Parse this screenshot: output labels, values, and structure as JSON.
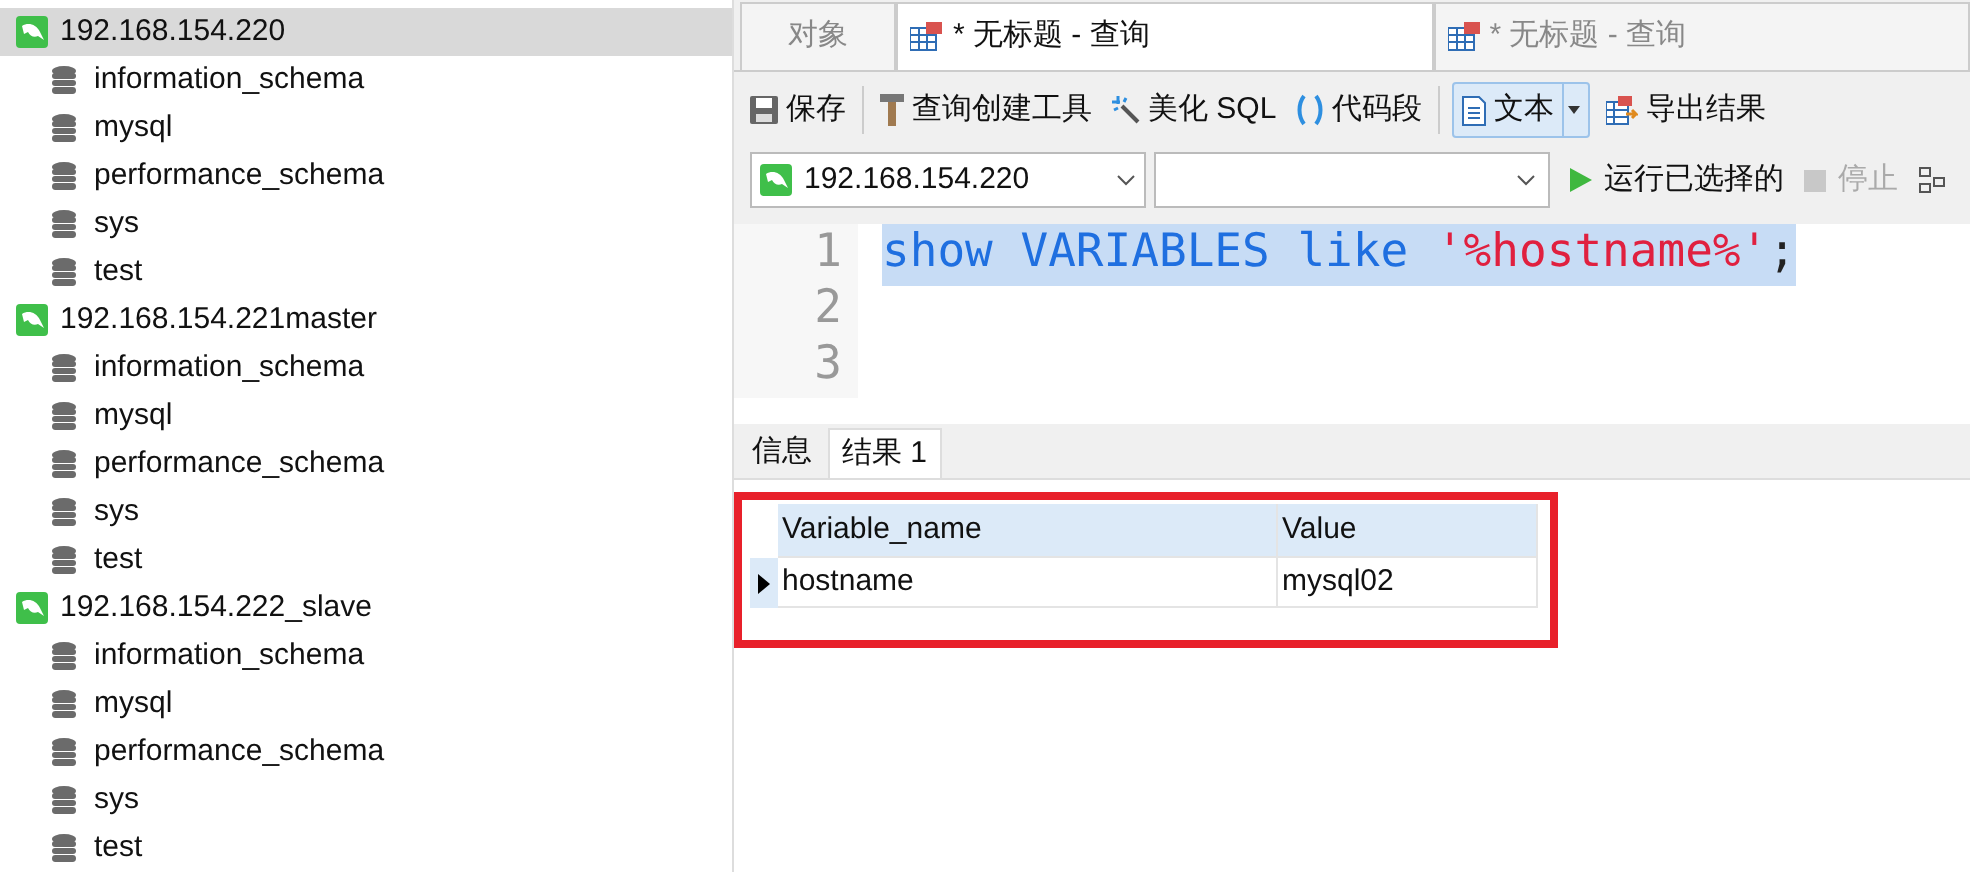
{
  "sidebar": {
    "connections": [
      {
        "name": "192.168.154.220",
        "selected": true,
        "children": [
          {
            "name": "information_schema"
          },
          {
            "name": "mysql"
          },
          {
            "name": "performance_schema"
          },
          {
            "name": "sys"
          },
          {
            "name": "test"
          }
        ]
      },
      {
        "name": "192.168.154.221master",
        "selected": false,
        "children": [
          {
            "name": "information_schema"
          },
          {
            "name": "mysql"
          },
          {
            "name": "performance_schema"
          },
          {
            "name": "sys"
          },
          {
            "name": "test"
          }
        ]
      },
      {
        "name": "192.168.154.222_slave",
        "selected": false,
        "children": [
          {
            "name": "information_schema"
          },
          {
            "name": "mysql"
          },
          {
            "name": "performance_schema"
          },
          {
            "name": "sys"
          },
          {
            "name": "test"
          }
        ]
      }
    ]
  },
  "tabs": [
    {
      "label": "对象",
      "kind": "plain",
      "selected": false
    },
    {
      "label": "* 无标题 - 查询",
      "kind": "query",
      "selected": true
    },
    {
      "label": "* 无标题 - 查询",
      "kind": "query",
      "selected": false
    }
  ],
  "toolbar": [
    {
      "label": "保存",
      "kind": "save"
    },
    {
      "label": "查询创建工具",
      "kind": "builder"
    },
    {
      "label": "美化 SQL",
      "kind": "beautify"
    },
    {
      "label": "代码段",
      "kind": "snippet"
    },
    {
      "label": "文本",
      "kind": "text"
    },
    {
      "label": "导出结果",
      "kind": "export"
    }
  ],
  "connection_select": {
    "value": "192.168.154.220"
  },
  "actions": [
    {
      "label": "运行已选择的",
      "disabled": false
    },
    {
      "label": "停止",
      "disabled": true
    }
  ],
  "editor": {
    "lines": [
      {
        "number": "1",
        "selected": true,
        "tokens": [
          {
            "text": "show VARIABLES like ",
            "kind": "keyword"
          },
          {
            "text": "'%hostname%'",
            "kind": "string"
          },
          {
            "text": ";",
            "kind": "plain"
          }
        ]
      },
      {
        "number": "2",
        "selected": false
      },
      {
        "number": "3",
        "selected": false
      }
    ]
  },
  "result_tabs": [
    {
      "label": "信息",
      "selected": false
    },
    {
      "label": "结果 1",
      "selected": true
    }
  ],
  "table": {
    "columns": [
      "Variable_name",
      "Value"
    ],
    "rows": [
      {
        "cells": [
          "hostname",
          "mysql02"
        ],
        "selected": true
      }
    ]
  }
}
